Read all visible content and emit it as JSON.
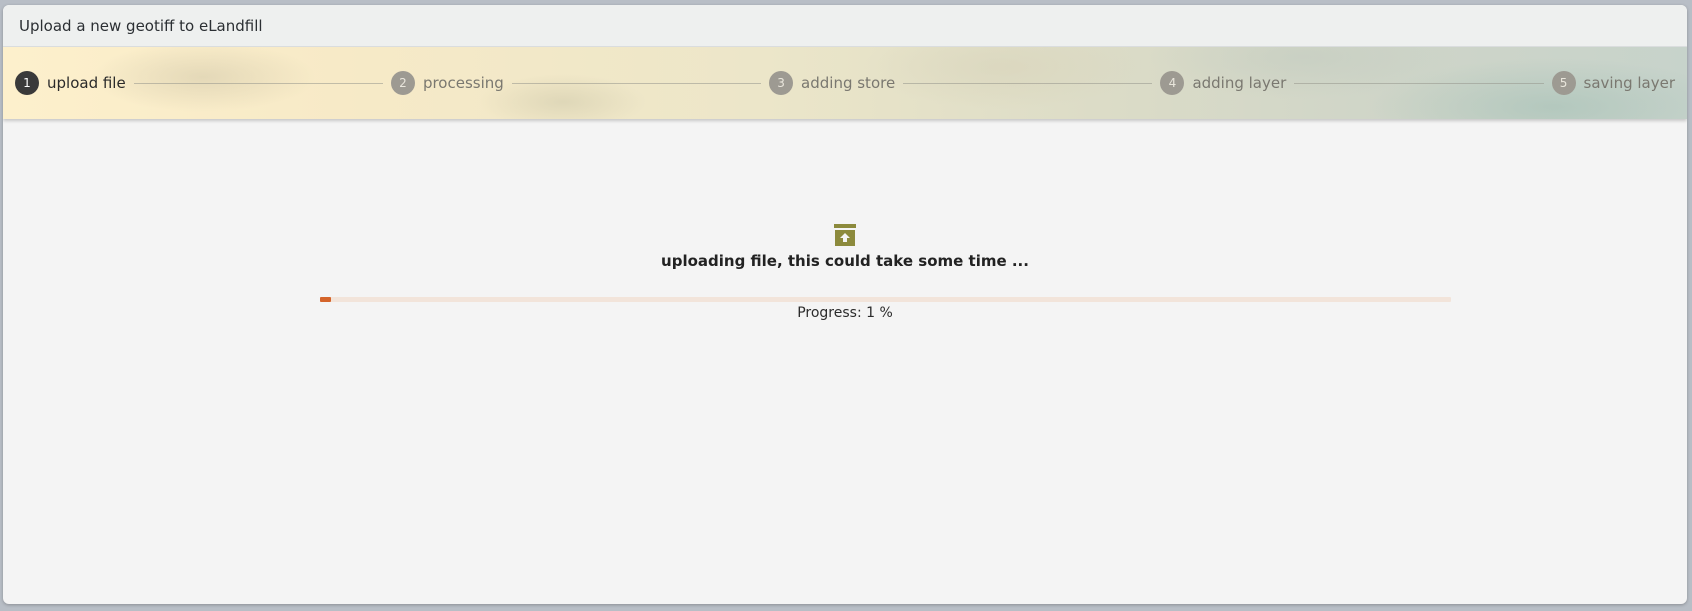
{
  "window": {
    "title": "Upload a new geotiff to eLandfill"
  },
  "steps": [
    {
      "number": "1",
      "label": "upload file",
      "active": true
    },
    {
      "number": "2",
      "label": "processing",
      "active": false
    },
    {
      "number": "3",
      "label": "adding store",
      "active": false
    },
    {
      "number": "4",
      "label": "adding layer",
      "active": false
    },
    {
      "number": "5",
      "label": "saving layer",
      "active": false
    }
  ],
  "upload": {
    "icon": "upload-archive-icon",
    "message": "uploading file, this could take some time ...",
    "progress_percent": 1,
    "progress_text": "Progress: 1 %"
  },
  "colors": {
    "icon": "#8c8a3c",
    "progress_fill": "#d4642a",
    "progress_track": "#f2e4da",
    "active_step": "#3a3a3a",
    "inactive_step": "#9d9a92"
  }
}
